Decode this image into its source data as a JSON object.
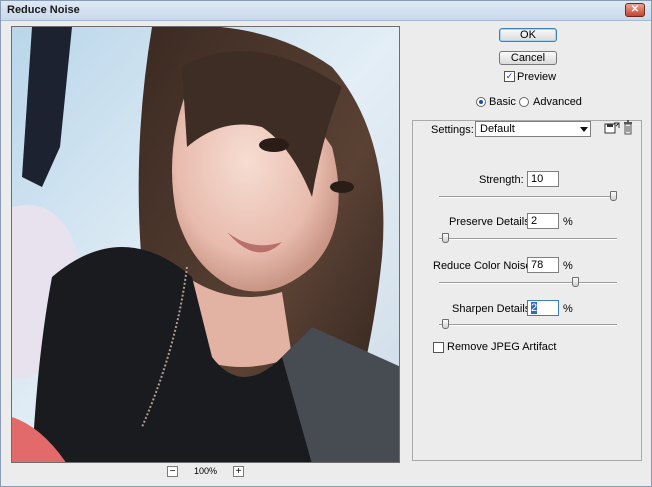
{
  "window": {
    "title": "Reduce Noise",
    "close_label": "✕"
  },
  "preview": {
    "zoom_level": "100%",
    "zoom_out": "−",
    "zoom_in": "+"
  },
  "buttons": {
    "ok": "OK",
    "cancel": "Cancel"
  },
  "preview_toggle": {
    "label": "Preview",
    "checked": true
  },
  "mode": {
    "basic": "Basic",
    "advanced": "Advanced",
    "selected": "basic"
  },
  "settings": {
    "label": "Settings:",
    "value": "Default"
  },
  "controls": [
    {
      "label": "Strength:",
      "value": "10",
      "unit": "",
      "fraction": 1.0
    },
    {
      "label": "Preserve Details:",
      "value": "2",
      "unit": "%",
      "fraction": 0.02
    },
    {
      "label": "Reduce Color Noise:",
      "value": "78",
      "unit": "%",
      "fraction": 0.78
    },
    {
      "label": "Sharpen Details:",
      "value": "2",
      "unit": "%",
      "fraction": 0.02
    }
  ],
  "remove_jpeg": {
    "label": "Remove JPEG Artifact",
    "checked": false
  }
}
